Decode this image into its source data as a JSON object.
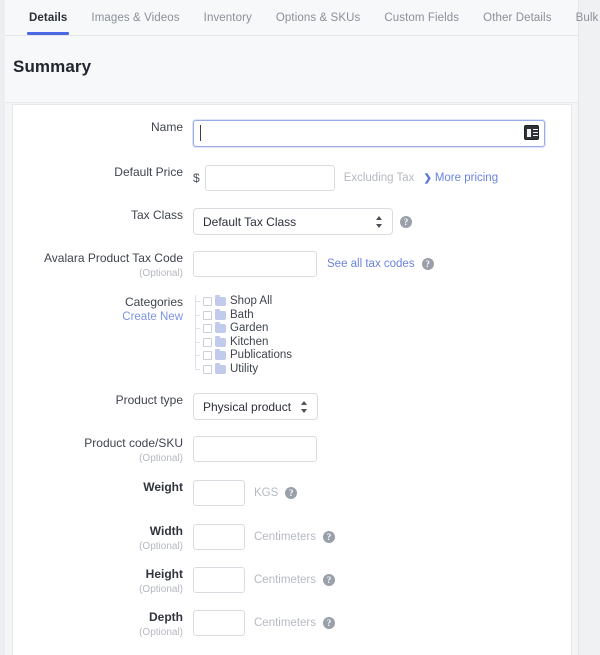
{
  "tabs": [
    {
      "label": "Details",
      "active": true
    },
    {
      "label": "Images & Videos",
      "active": false
    },
    {
      "label": "Inventory",
      "active": false
    },
    {
      "label": "Options & SKUs",
      "active": false
    },
    {
      "label": "Custom Fields",
      "active": false
    },
    {
      "label": "Other Details",
      "active": false
    },
    {
      "label": "Bulk Pricing",
      "active": false
    }
  ],
  "section": {
    "title": "Summary"
  },
  "form": {
    "name": {
      "label": "Name",
      "value": "",
      "placeholder": "",
      "icon": "contact-card-icon"
    },
    "default_price": {
      "label": "Default Price",
      "currency_symbol": "$",
      "value": "",
      "placeholder": "",
      "tax_note": "Excluding Tax",
      "more_link": "More pricing",
      "chevron": "❯"
    },
    "tax_class": {
      "label": "Tax Class",
      "selected": "Default Tax Class",
      "options": [
        "Default Tax Class"
      ],
      "help": "?"
    },
    "avalara": {
      "label": "Avalara Product Tax Code",
      "optional": "(Optional)",
      "value": "",
      "placeholder": "",
      "link": "See all tax codes",
      "help": "?"
    },
    "categories": {
      "label": "Categories",
      "create_new": "Create New",
      "items": [
        {
          "label": "Shop All",
          "checked": false
        },
        {
          "label": "Bath",
          "checked": false
        },
        {
          "label": "Garden",
          "checked": false
        },
        {
          "label": "Kitchen",
          "checked": false
        },
        {
          "label": "Publications",
          "checked": false
        },
        {
          "label": "Utility",
          "checked": false
        }
      ]
    },
    "product_type": {
      "label": "Product type",
      "selected": "Physical product",
      "options": [
        "Physical product"
      ]
    },
    "sku": {
      "label": "Product code/SKU",
      "optional": "(Optional)",
      "value": "",
      "placeholder": ""
    },
    "weight": {
      "label": "Weight",
      "value": "",
      "placeholder": "",
      "unit": "KGS",
      "help": "?"
    },
    "width": {
      "label": "Width",
      "optional": "(Optional)",
      "value": "",
      "placeholder": "",
      "unit": "Centimeters",
      "help": "?"
    },
    "height": {
      "label": "Height",
      "optional": "(Optional)",
      "value": "",
      "placeholder": "",
      "unit": "Centimeters",
      "help": "?"
    },
    "depth": {
      "label": "Depth",
      "optional": "(Optional)",
      "value": "",
      "placeholder": "",
      "unit": "Centimeters",
      "help": "?"
    }
  },
  "colors": {
    "accent": "#4a69e2",
    "link": "#6b83e0",
    "folder": "#c3cbec",
    "muted": "#b6bac2",
    "page_bg": "#f4f5f7"
  }
}
